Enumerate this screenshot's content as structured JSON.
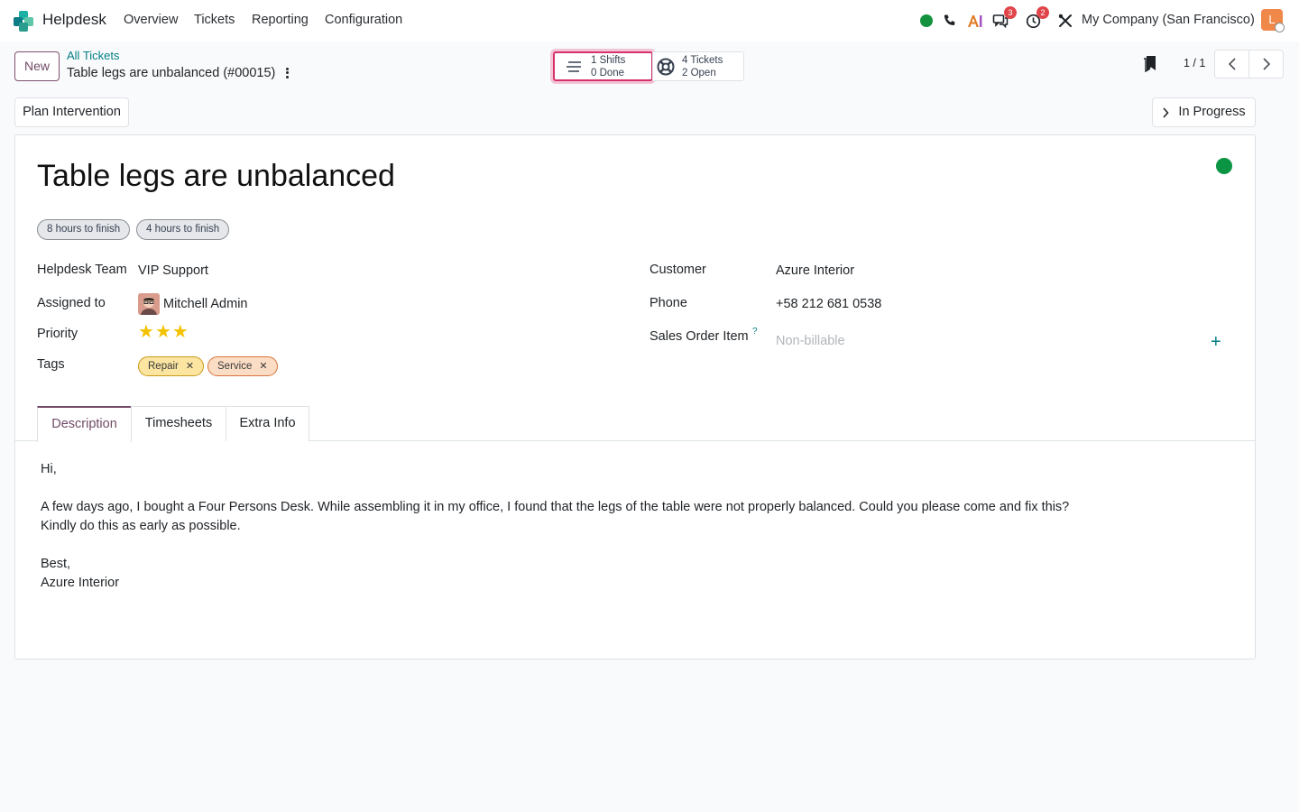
{
  "navbar": {
    "app_name": "Helpdesk",
    "menu": [
      "Overview",
      "Tickets",
      "Reporting",
      "Configuration"
    ],
    "icons": [
      "status-online-icon",
      "phone-icon",
      "ai-icon",
      "messages-icon",
      "activity-clock-icon",
      "debug-tools-icon"
    ],
    "messages_badge": "3",
    "activities_badge": "2",
    "company": "My Company (San Francisco)",
    "user_initial": "L"
  },
  "control_panel": {
    "new_label": "New",
    "breadcrumb": "All Tickets",
    "record_title": "Table legs are unbalanced (#00015)",
    "stat_shifts": {
      "line1": "1 Shifts",
      "line2": "0 Done"
    },
    "stat_tickets": {
      "line1": "4 Tickets",
      "line2": "2 Open"
    },
    "pager": "1 / 1"
  },
  "statusbar": {
    "plan_label": "Plan Intervention",
    "stage": "In Progress"
  },
  "form": {
    "title": "Table legs are unbalanced",
    "kanban_state_color": "#0b9444",
    "sla_tags": [
      "8 hours to finish",
      "4 hours to finish"
    ],
    "left_fields": {
      "team_label": "Helpdesk Team",
      "team_value": "VIP Support",
      "assigned_label": "Assigned to",
      "assigned_value": "Mitchell Admin",
      "priority_label": "Priority",
      "priority_stars": 3,
      "tags_label": "Tags",
      "tags": [
        "Repair",
        "Service"
      ]
    },
    "right_fields": {
      "customer_label": "Customer",
      "customer_value": "Azure Interior",
      "phone_label": "Phone",
      "phone_value": "+58 212 681 0538",
      "soi_label": "Sales Order Item",
      "soi_help": "?",
      "soi_placeholder": "Non-billable",
      "add_symbol": "+"
    },
    "tabs": [
      "Description",
      "Timesheets",
      "Extra Info"
    ],
    "description": {
      "greeting": "Hi,",
      "line1": "A few days ago, I bought a Four Persons Desk. While assembling it in my office, I found that the legs of the table were not properly balanced. Could you please come and fix this?",
      "line2": "Kindly do this as early as possible.",
      "signoff": "Best,",
      "signature": "Azure Interior"
    }
  },
  "colors": {
    "brand": "#714b67",
    "link": "#017e84",
    "highlight": "#d6336c"
  }
}
